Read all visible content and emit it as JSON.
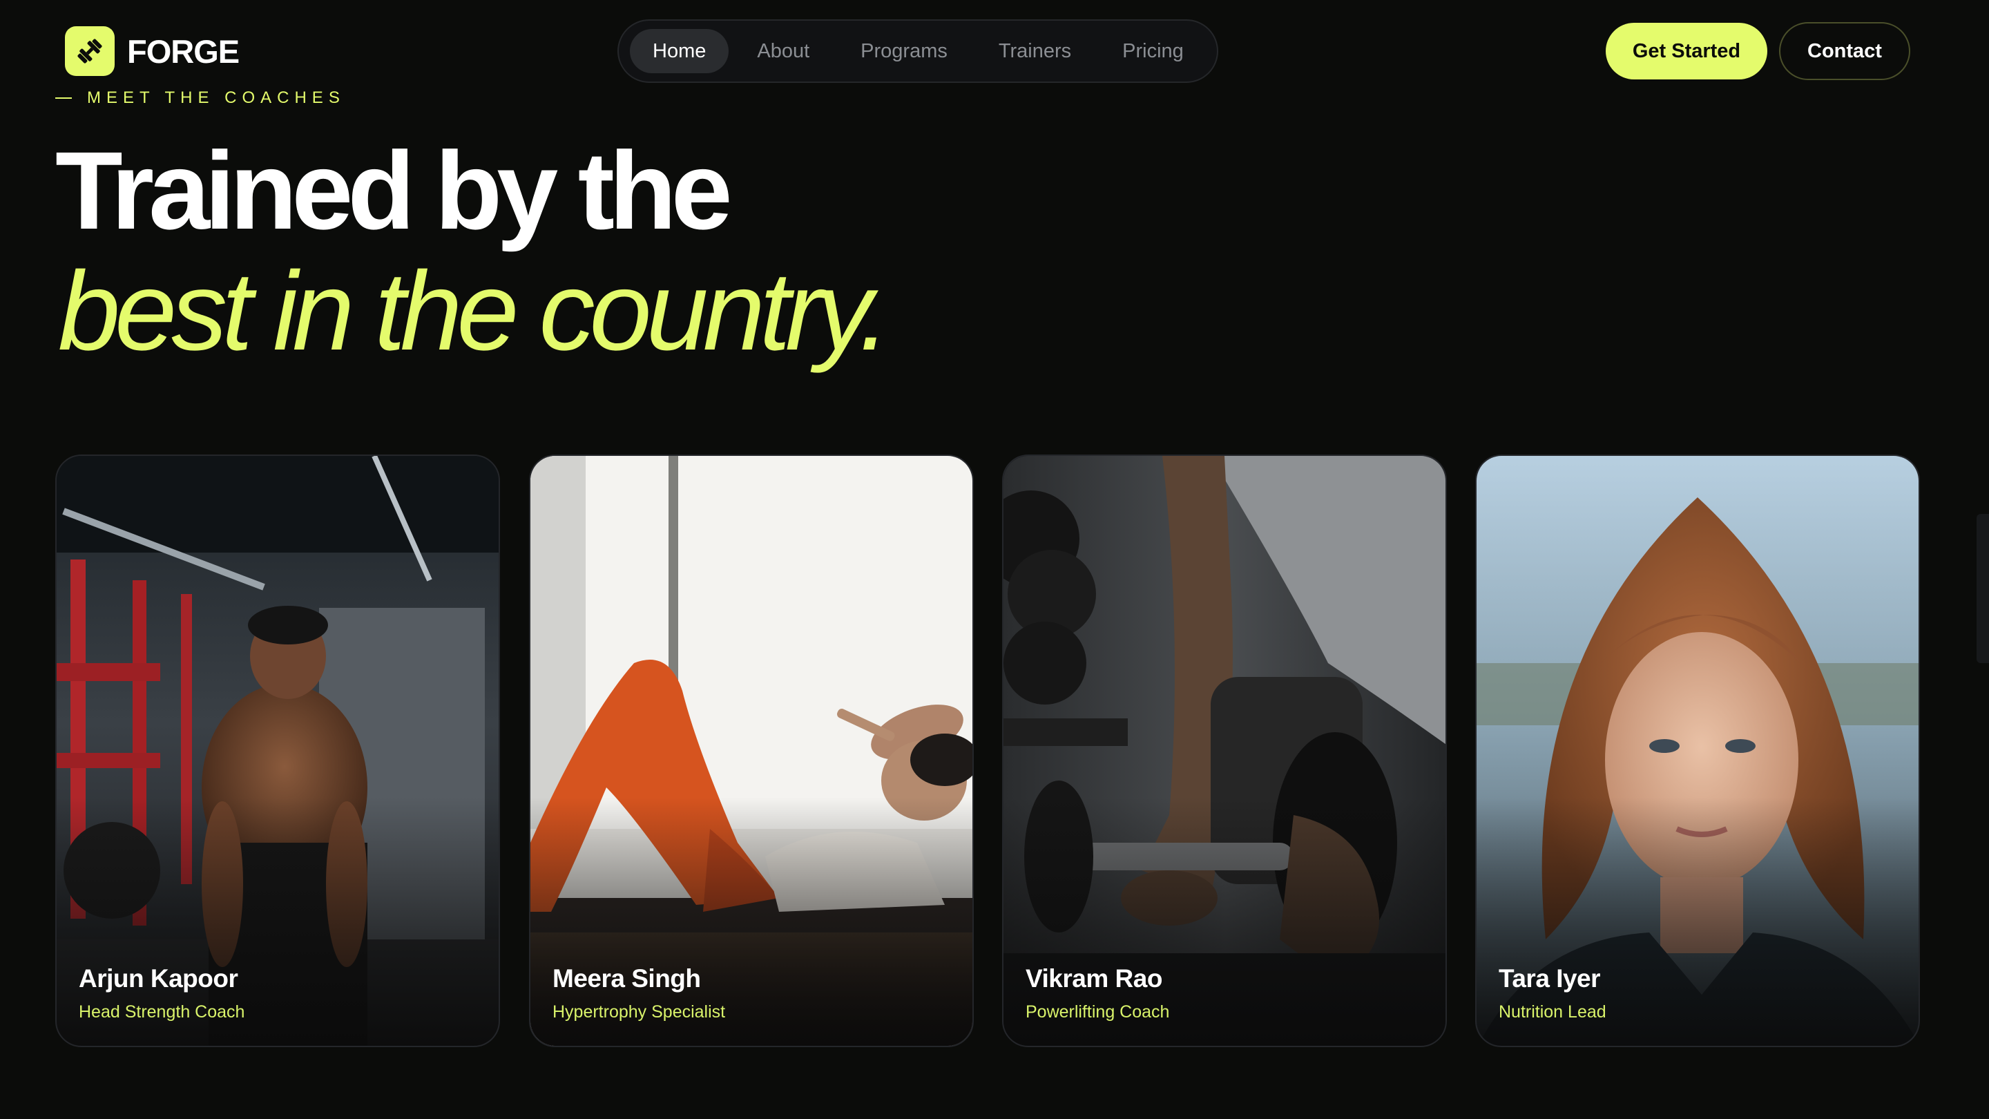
{
  "brand": {
    "name": "FORGE",
    "icon": "dumbbell-icon",
    "accent": "#e4fb6c"
  },
  "nav": {
    "items": [
      {
        "label": "Home",
        "active": true
      },
      {
        "label": "About",
        "active": false
      },
      {
        "label": "Programs",
        "active": false
      },
      {
        "label": "Trainers",
        "active": false
      },
      {
        "label": "Pricing",
        "active": false
      }
    ]
  },
  "header": {
    "cta_primary": "Get Started",
    "cta_secondary": "Contact"
  },
  "hero": {
    "eyebrow": "MEET THE COACHES",
    "title_line1": "Trained by the",
    "title_line2": "best in the country."
  },
  "coaches": [
    {
      "name": "Arjun Kapoor",
      "role": "Head Strength Coach"
    },
    {
      "name": "Meera Singh",
      "role": "Hypertrophy Specialist"
    },
    {
      "name": "Vikram Rao",
      "role": "Powerlifting Coach"
    },
    {
      "name": "Tara Iyer",
      "role": "Nutrition Lead"
    }
  ]
}
